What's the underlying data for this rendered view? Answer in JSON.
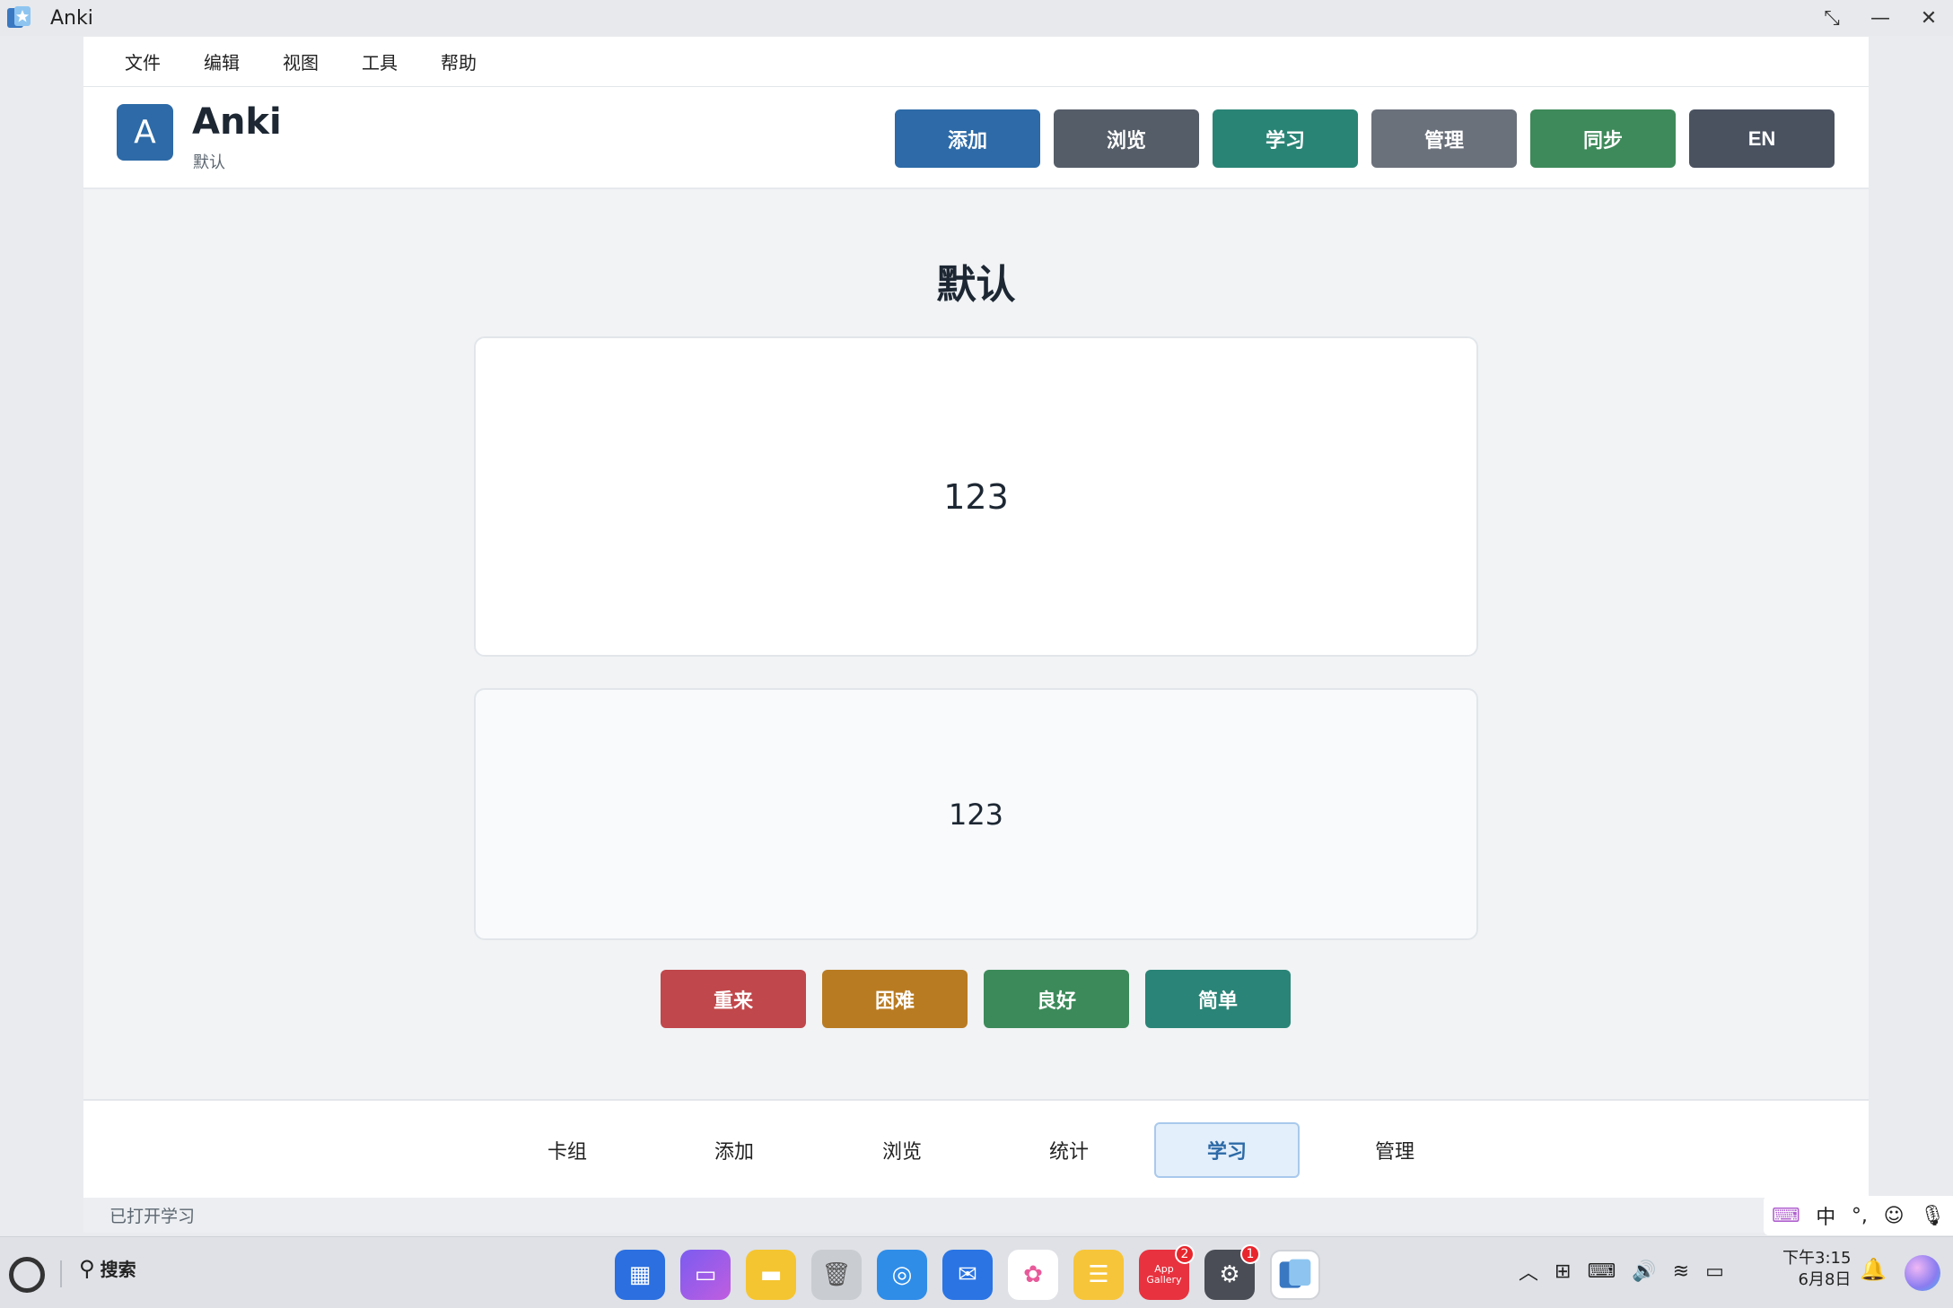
{
  "window": {
    "title": "Anki"
  },
  "menu": [
    "文件",
    "编辑",
    "视图",
    "工具",
    "帮助"
  ],
  "header": {
    "logo_letter": "A",
    "app_name": "Anki",
    "deck": "默认",
    "buttons": [
      {
        "label": "添加",
        "color": "#2d6aa7"
      },
      {
        "label": "浏览",
        "color": "#555d68"
      },
      {
        "label": "学习",
        "color": "#2a8476"
      },
      {
        "label": "管理",
        "color": "#6b717b"
      },
      {
        "label": "同步",
        "color": "#3e8a5a"
      },
      {
        "label": "EN",
        "color": "#4a5260"
      }
    ]
  },
  "study": {
    "deck_title": "默认",
    "front": "123",
    "back": "123",
    "answer_buttons": [
      {
        "label": "重来",
        "color": "#c0474b"
      },
      {
        "label": "困难",
        "color": "#b97b22"
      },
      {
        "label": "良好",
        "color": "#3c8a5a"
      },
      {
        "label": "简单",
        "color": "#2a8477"
      }
    ]
  },
  "bottom_tabs": [
    {
      "label": "卡组",
      "active": false
    },
    {
      "label": "添加",
      "active": false
    },
    {
      "label": "浏览",
      "active": false
    },
    {
      "label": "统计",
      "active": false
    },
    {
      "label": "学习",
      "active": true
    },
    {
      "label": "管理",
      "active": false
    }
  ],
  "status": "已打开学习",
  "ime": [
    "中",
    "°,"
  ],
  "taskbar": {
    "search_label": "搜索",
    "app_gallery_badge": "2",
    "settings_badge": "1",
    "app_gallery_text": "App Gallery",
    "time": "下午3:15",
    "date": "6月8日"
  }
}
